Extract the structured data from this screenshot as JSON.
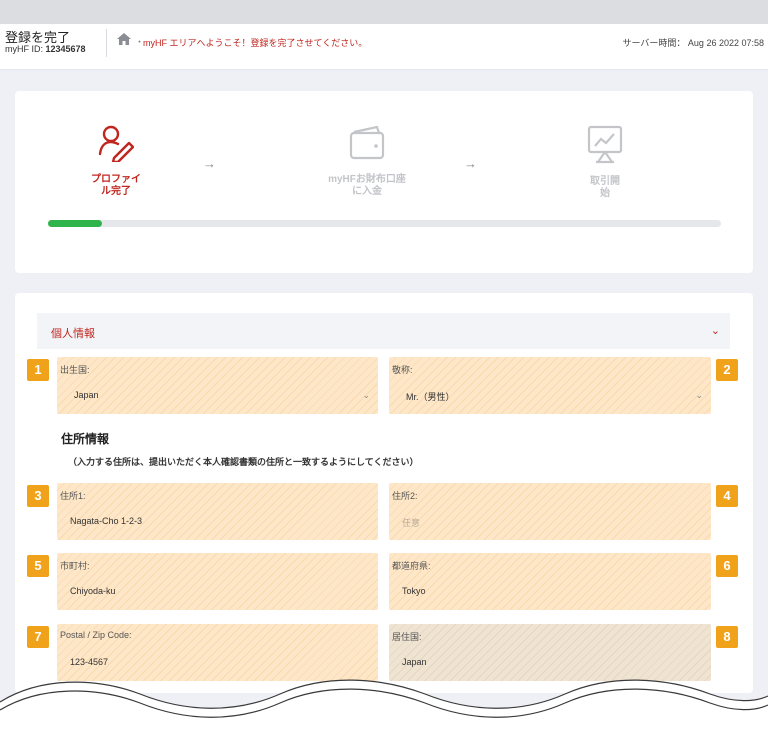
{
  "header": {
    "title": "登録を完了",
    "id_label": "myHF ID:",
    "id_value": "12345678",
    "dot": "・",
    "welcome": "myHF エリアへようこそ！登録を完了させてください。",
    "server_time": "サーバー時間： Aug 26 2022 07:58"
  },
  "steps": [
    {
      "label": "プロファイ\nル完了",
      "icon": "user-edit-icon",
      "state": "active"
    },
    {
      "label": "myHFお財布口座\nに入金",
      "icon": "wallet-icon",
      "state": "inactive"
    },
    {
      "label": "取引開\n始",
      "icon": "chart-monitor-icon",
      "state": "inactive"
    }
  ],
  "progress_fraction": 0.08,
  "colors": {
    "brand_red": "#c0261f",
    "progress_green": "#2fb34b",
    "badge_orange": "#f1a21b",
    "field_highlight": "#fde7c8"
  },
  "section": {
    "title": "個人情報",
    "chevron": "⌄"
  },
  "address": {
    "title": "住所情報",
    "note": "（入力する住所は、提出いただく本人確認書類の住所と一致するようにしてください）"
  },
  "fields": {
    "birth_country": {
      "badge": "1",
      "label": "出生国:",
      "value": "Japan"
    },
    "salutation": {
      "badge": "2",
      "label": "敬称:",
      "value": "Mr.（男性）"
    },
    "address1": {
      "badge": "3",
      "label": "住所1:",
      "value": "Nagata-Cho 1-2-3"
    },
    "address2": {
      "badge": "4",
      "label": "住所2:",
      "placeholder": "任意"
    },
    "city": {
      "badge": "5",
      "label": "市町村:",
      "value": "Chiyoda-ku"
    },
    "prefecture": {
      "badge": "6",
      "label": "都道府県:",
      "value": "Tokyo"
    },
    "postal": {
      "badge": "7",
      "label": "Postal / Zip Code:",
      "value": "123-4567"
    },
    "country": {
      "badge": "8",
      "label": "居住国:",
      "value": "Japan"
    }
  }
}
